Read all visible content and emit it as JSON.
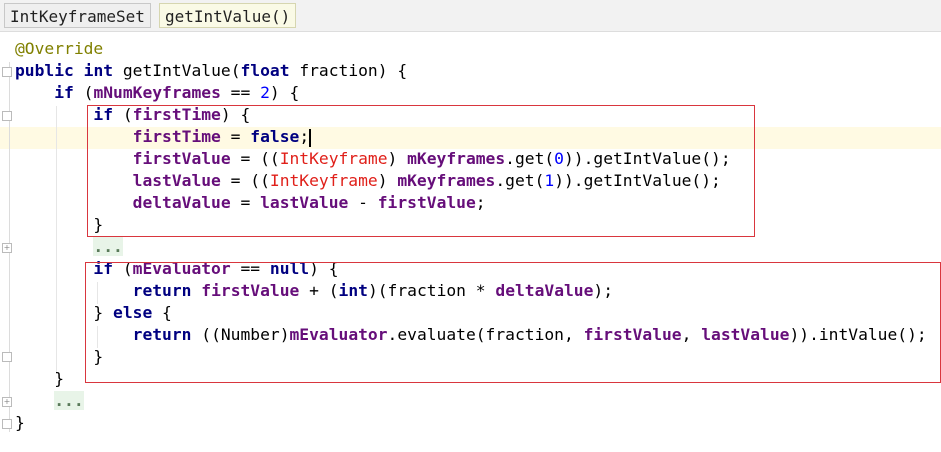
{
  "breadcrumbs": [
    "IntKeyframeSet",
    "getIntValue()"
  ],
  "colors": {
    "keyword": "#000080",
    "field": "#660e7a",
    "number": "#0000ff",
    "annotation": "#808000",
    "type": "#e0201a",
    "highlight_box": "#d9363e"
  },
  "code_lines": [
    [
      [
        "ann",
        "@Override"
      ]
    ],
    [
      [
        "kw",
        "public"
      ],
      [
        "",
        ""
      ],
      [
        "",
        " "
      ],
      [
        "kw",
        "int"
      ],
      [
        "",
        " getIntValue("
      ],
      [
        "kw",
        "float"
      ],
      [
        "",
        " fraction) {"
      ]
    ],
    [
      [
        "",
        "    "
      ],
      [
        "kw",
        "if"
      ],
      [
        "",
        " ("
      ],
      [
        "fd",
        "mNumKeyframes"
      ],
      [
        "",
        " == "
      ],
      [
        "num",
        "2"
      ],
      [
        "",
        ") {"
      ]
    ],
    [
      [
        "",
        "        "
      ],
      [
        "kw",
        "if"
      ],
      [
        "",
        " ("
      ],
      [
        "fd",
        "firstTime"
      ],
      [
        "",
        ") {"
      ]
    ],
    [
      [
        "",
        "            "
      ],
      [
        "fd",
        "firstTime"
      ],
      [
        "",
        " = "
      ],
      [
        "kw",
        "false"
      ],
      [
        "",
        ";"
      ],
      [
        "caret",
        ""
      ]
    ],
    [
      [
        "",
        "            "
      ],
      [
        "fd",
        "firstValue"
      ],
      [
        "",
        " = (("
      ],
      [
        "typ",
        "IntKeyframe"
      ],
      [
        "",
        ") "
      ],
      [
        "fd",
        "mKeyframes"
      ],
      [
        "",
        ".get("
      ],
      [
        "num",
        "0"
      ],
      [
        "",
        "))"
      ],
      [
        "",
        ".getIntValue();"
      ]
    ],
    [
      [
        "",
        "            "
      ],
      [
        "fd",
        "lastValue"
      ],
      [
        "",
        " = (("
      ],
      [
        "typ",
        "IntKeyframe"
      ],
      [
        "",
        ") "
      ],
      [
        "fd",
        "mKeyframes"
      ],
      [
        "",
        ".get("
      ],
      [
        "num",
        "1"
      ],
      [
        "",
        "))"
      ],
      [
        "",
        ".getIntValue();"
      ]
    ],
    [
      [
        "",
        "            "
      ],
      [
        "fd",
        "deltaValue"
      ],
      [
        "",
        " = "
      ],
      [
        "fd",
        "lastValue"
      ],
      [
        "",
        " - "
      ],
      [
        "fd",
        "firstValue"
      ],
      [
        "",
        ";"
      ]
    ],
    [
      [
        "",
        "        }"
      ]
    ],
    [
      [
        "",
        "        "
      ],
      [
        "dots",
        "..."
      ]
    ],
    [
      [
        "",
        "        "
      ],
      [
        "kw",
        "if"
      ],
      [
        "",
        " ("
      ],
      [
        "fd",
        "mEvaluator"
      ],
      [
        "",
        " == "
      ],
      [
        "kw",
        "null"
      ],
      [
        "",
        ") {"
      ]
    ],
    [
      [
        "",
        "            "
      ],
      [
        "kw",
        "return"
      ],
      [
        "",
        " "
      ],
      [
        "fd",
        "firstValue"
      ],
      [
        "",
        " + ("
      ],
      [
        "kw",
        "int"
      ],
      [
        "",
        ")(fraction * "
      ],
      [
        "fd",
        "deltaValue"
      ],
      [
        "",
        ");"
      ]
    ],
    [
      [
        "",
        "        } "
      ],
      [
        "kw",
        "else"
      ],
      [
        "",
        " {"
      ]
    ],
    [
      [
        "",
        "            "
      ],
      [
        "kw",
        "return"
      ],
      [
        "",
        " ((Number)"
      ],
      [
        "fd",
        "mEvaluator"
      ],
      [
        "",
        ".evaluate(fraction, "
      ],
      [
        "fd",
        "firstValue"
      ],
      [
        "",
        ", "
      ],
      [
        "fd",
        "lastValue"
      ],
      [
        "",
        "))"
      ],
      [
        "",
        ".intValue();"
      ]
    ],
    [
      [
        "",
        "        }"
      ]
    ],
    [
      [
        "",
        "    }"
      ]
    ],
    [
      [
        "",
        "    "
      ],
      [
        "dots",
        "..."
      ]
    ],
    [
      [
        "",
        "}"
      ]
    ]
  ]
}
